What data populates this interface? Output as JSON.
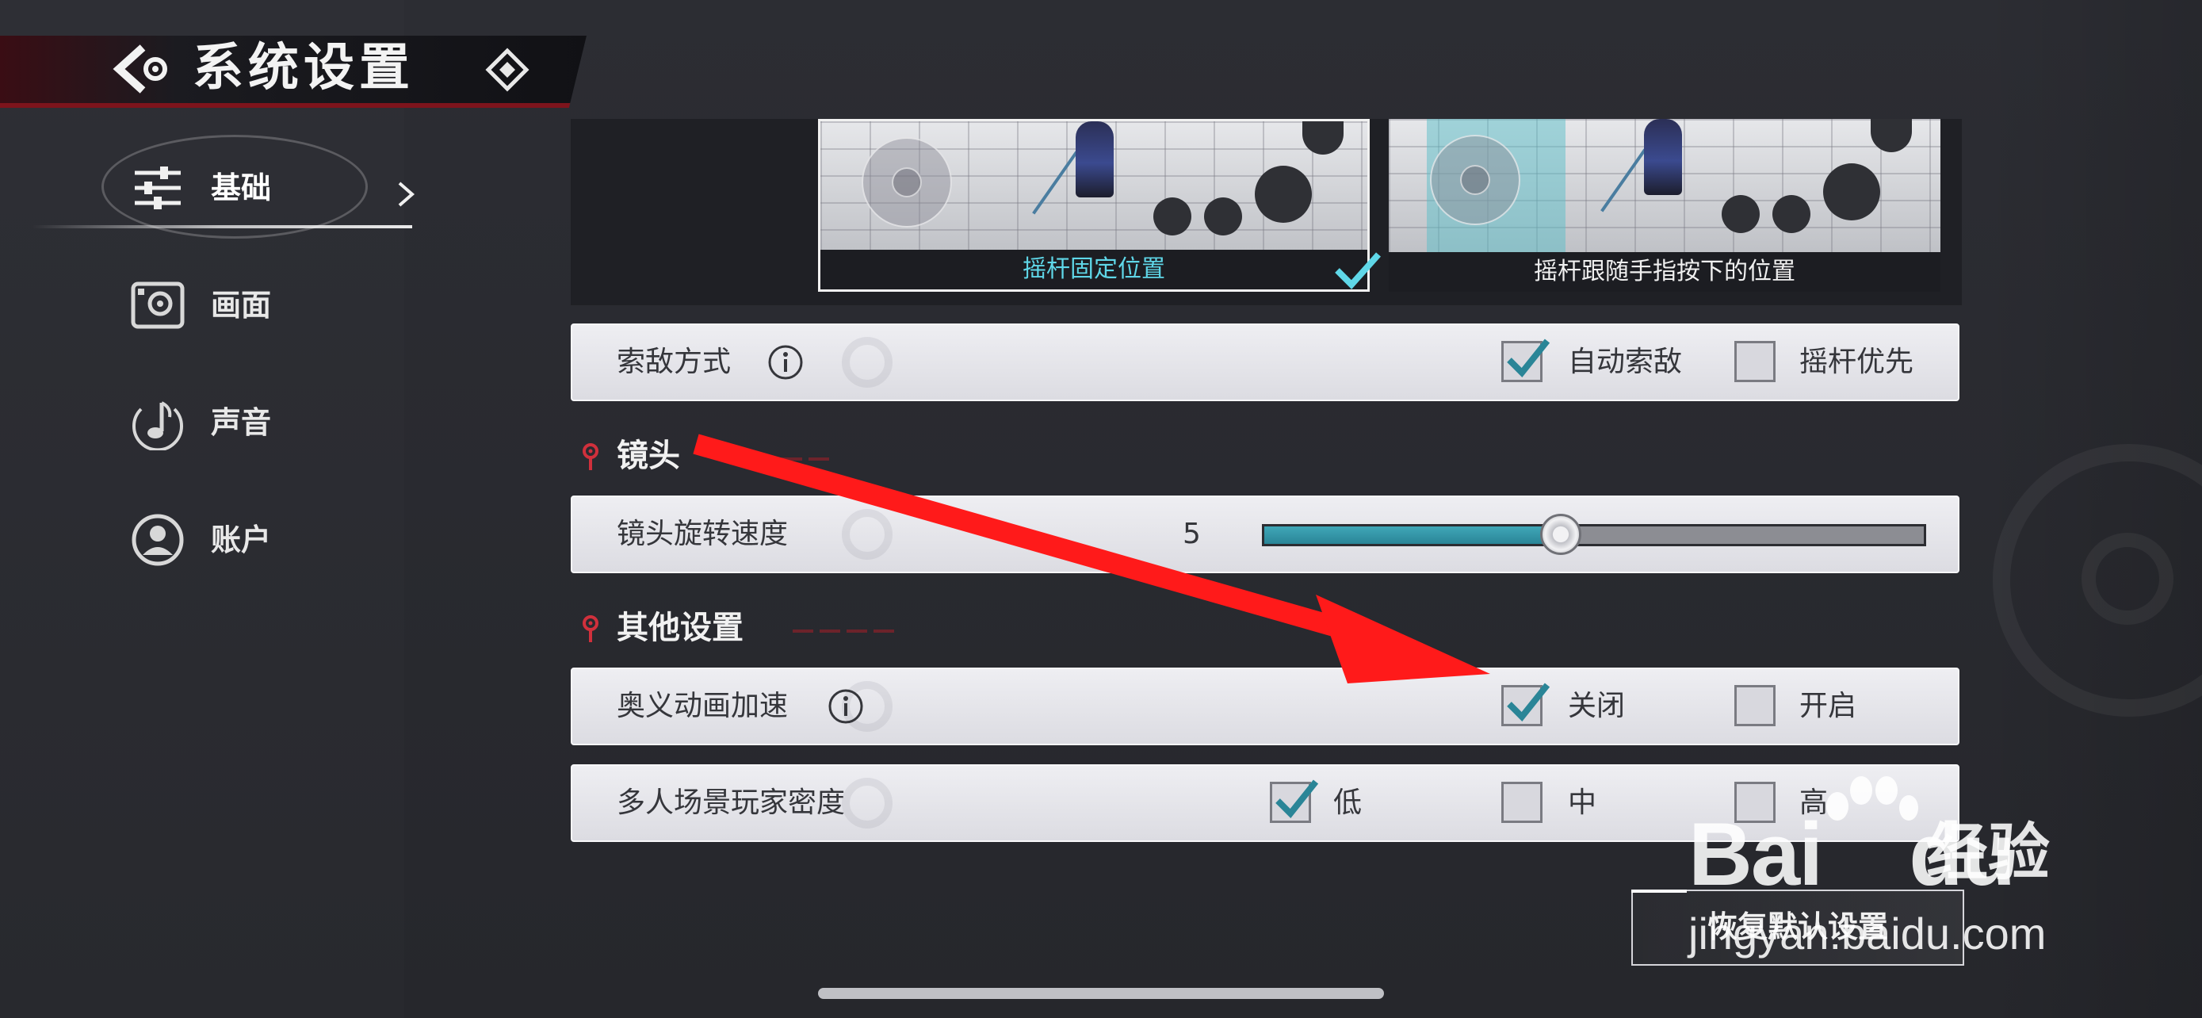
{
  "header": {
    "title": "系统设置"
  },
  "sidebar": {
    "items": [
      {
        "label": "基础",
        "icon": "sliders-icon",
        "active": true
      },
      {
        "label": "画面",
        "icon": "display-icon",
        "active": false
      },
      {
        "label": "声音",
        "icon": "music-note-icon",
        "active": false
      },
      {
        "label": "账户",
        "icon": "user-icon",
        "active": false
      }
    ]
  },
  "joystick": {
    "options": [
      {
        "caption": "摇杆固定位置",
        "selected": true
      },
      {
        "caption": "摇杆跟随手指按下的位置",
        "selected": false
      }
    ]
  },
  "targeting": {
    "label": "索敌方式",
    "options": [
      {
        "label": "自动索敌",
        "checked": true
      },
      {
        "label": "摇杆优先",
        "checked": false
      }
    ]
  },
  "camera": {
    "section_title": "镜头",
    "rotation_label": "镜头旋转速度",
    "rotation_value": "5",
    "rotation_fraction": 0.45
  },
  "other": {
    "section_title": "其他设置",
    "ultimate_anim": {
      "label": "奥义动画加速",
      "options": [
        {
          "label": "关闭",
          "checked": true
        },
        {
          "label": "开启",
          "checked": false
        }
      ]
    },
    "density": {
      "label": "多人场景玩家密度",
      "options": [
        {
          "label": "低",
          "checked": true
        },
        {
          "label": "中",
          "checked": false
        },
        {
          "label": "高",
          "checked": false
        }
      ]
    }
  },
  "reset_button": "恢复默认设置",
  "watermark": {
    "logo": "Bai",
    "logo_suffix": "du",
    "cn": "经验",
    "url": "jingyan.baidu.com"
  },
  "colors": {
    "accent_teal": "#2a8597",
    "arrow_red": "#ff1a1a",
    "header_red": "#7d141c"
  }
}
